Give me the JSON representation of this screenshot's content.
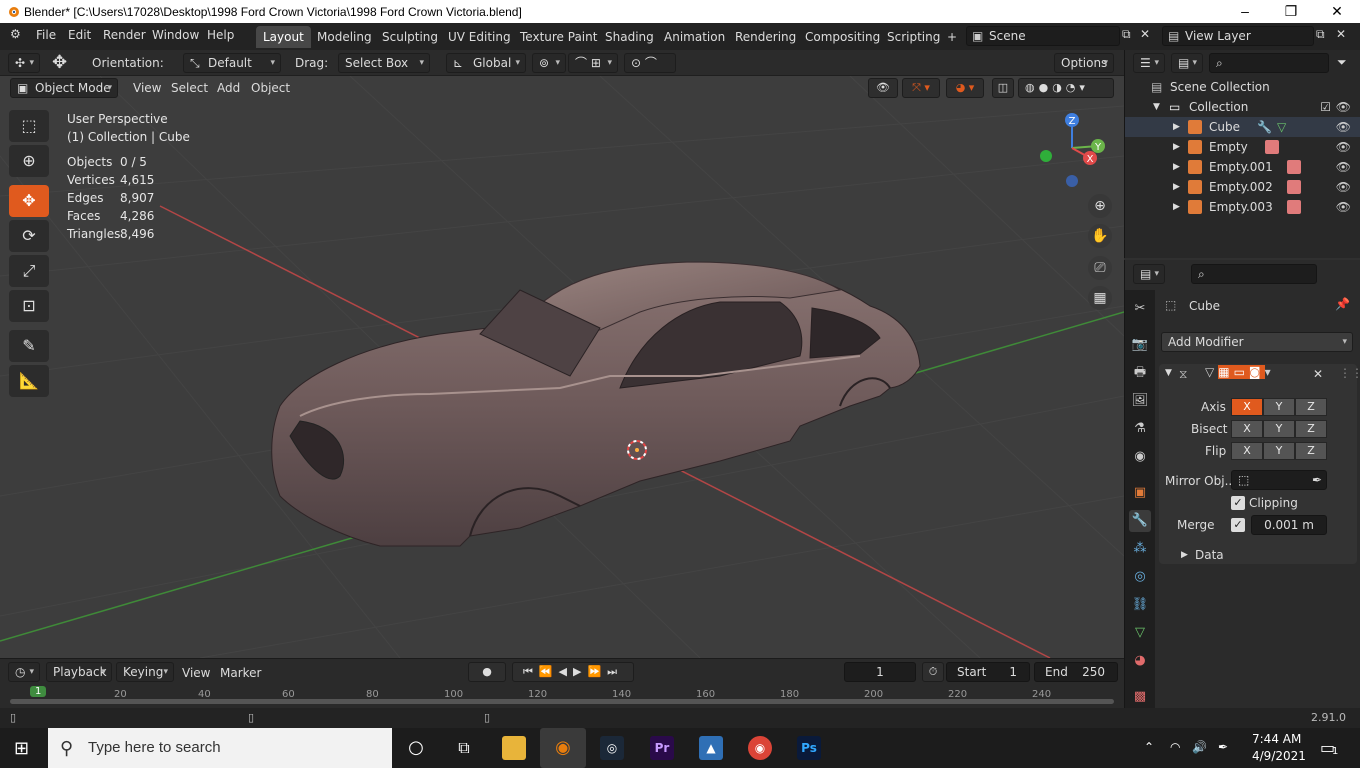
{
  "window": {
    "title": "Blender* [C:\\Users\\17028\\Desktop\\1998 Ford Crown Victoria\\1998 Ford Crown Victoria.blend]"
  },
  "menu": [
    "File",
    "Edit",
    "Render",
    "Window",
    "Help"
  ],
  "workspaces": [
    "Layout",
    "Modeling",
    "Sculpting",
    "UV Editing",
    "Texture Paint",
    "Shading",
    "Animation",
    "Rendering",
    "Compositing",
    "Scripting"
  ],
  "scene": {
    "name": "Scene",
    "view_layer": "View Layer"
  },
  "tool_header": {
    "orientation_label": "Orientation:",
    "orientation_value": "Default",
    "drag_label": "Drag:",
    "drag_value": "Select Box",
    "transform_value": "Global",
    "options_label": "Options"
  },
  "viewport_header": {
    "mode": "Object Mode",
    "menus": [
      "View",
      "Select",
      "Add",
      "Object"
    ]
  },
  "viewport_overlay": {
    "perspective": "User Perspective",
    "collection": "(1) Collection | Cube"
  },
  "stats": [
    {
      "k": "Objects",
      "v": "0 / 5"
    },
    {
      "k": "Vertices",
      "v": "4,615"
    },
    {
      "k": "Edges",
      "v": "8,907"
    },
    {
      "k": "Faces",
      "v": "4,286"
    },
    {
      "k": "Triangles",
      "v": "8,496"
    }
  ],
  "gizmo": {
    "x": "X",
    "y": "Y",
    "z": "Z"
  },
  "outliner": {
    "scene_collection": "Scene Collection",
    "collection": "Collection",
    "items": [
      "Cube",
      "Empty",
      "Empty.001",
      "Empty.002",
      "Empty.003"
    ]
  },
  "properties": {
    "object": "Cube",
    "add_modifier": "Add Modifier",
    "axis_label": "Axis",
    "bisect_label": "Bisect",
    "flip_label": "Flip",
    "x": "X",
    "y": "Y",
    "z": "Z",
    "mirror_obj_label": "Mirror Obj...",
    "clipping_label": "Clipping",
    "merge_label": "Merge",
    "merge_value": "0.001 m",
    "data_label": "Data"
  },
  "timeline": {
    "playback": "Playback",
    "keying": "Keying",
    "view": "View",
    "marker": "Marker",
    "current_frame": "1",
    "start_label": "Start",
    "start": "1",
    "end_label": "End",
    "end": "250",
    "ticks": [
      "1",
      "20",
      "40",
      "60",
      "80",
      "100",
      "120",
      "140",
      "160",
      "180",
      "200",
      "220",
      "240"
    ]
  },
  "status": {
    "version": "2.91.0"
  },
  "taskbar": {
    "search_placeholder": "Type here to search",
    "time": "7:44 AM",
    "date": "4/9/2021",
    "notif": "1"
  },
  "colors": {
    "accent": "#e05a1e",
    "header": "#232323",
    "viewport": "#3d3d3d",
    "x_axis": "#c84a4a",
    "y_axis": "#4a9a3e"
  }
}
